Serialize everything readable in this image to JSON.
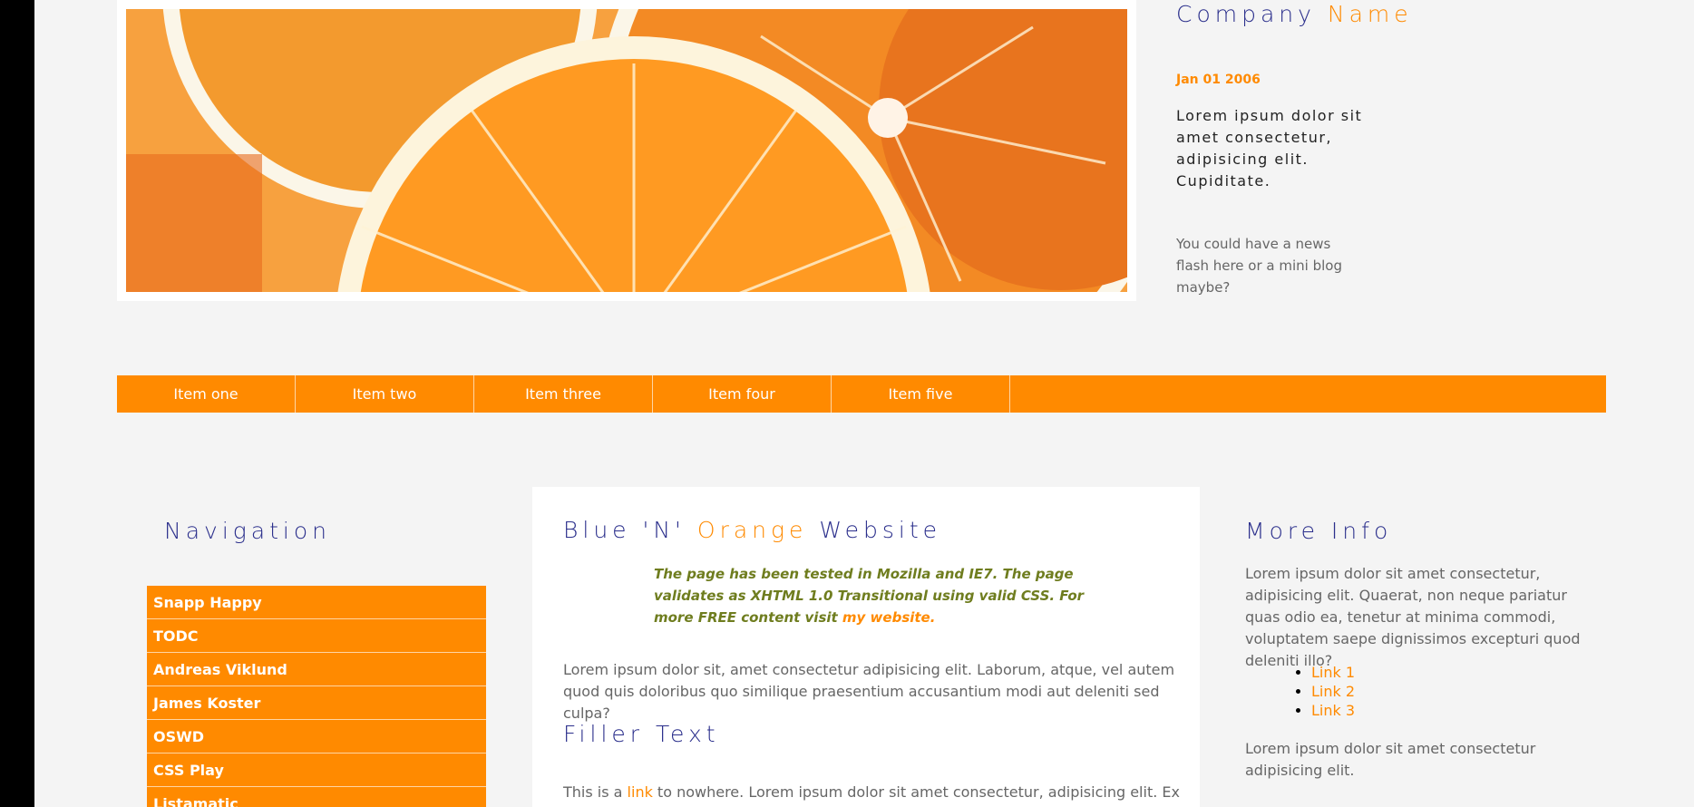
{
  "header": {
    "company_first": "Company",
    "company_second": "Name",
    "date": "Jan 01 2006",
    "tagline": "Lorem ipsum dolor sit amet consectetur, adipisicing elit. Cupiditate.",
    "news": "You could have a news flash here or a mini blog maybe?"
  },
  "topnav": {
    "items": [
      "Item one",
      "Item two",
      "Item three",
      "Item four",
      "Item five"
    ]
  },
  "sidebar": {
    "title": "Navigation",
    "items": [
      "Snapp Happy",
      "TODC",
      "Andreas Viklund",
      "James Koster",
      "OSWD",
      "CSS Play",
      "Listamatic"
    ]
  },
  "main": {
    "title_part1": "Blue 'N' ",
    "title_part2": "Orange",
    "title_part3": " Website",
    "quote_text": "The page has been tested in Mozilla and IE7. The page validates as XHTML 1.0 Transitional using valid CSS. For more FREE content visit ",
    "quote_link": "my website.",
    "para1": "Lorem ipsum dolor sit, amet consectetur adipisicing elit. Laborum, atque, vel autem quod quis doloribus quo similique praesentium accusantium modi aut deleniti sed culpa?",
    "filler_title": "Filler Text",
    "para2_before": "This is a ",
    "para2_link": "link",
    "para2_after": " to nowhere. Lorem ipsum dolor sit amet consectetur, adipisicing elit. Ex sapiente"
  },
  "more_info": {
    "title": "More Info",
    "para1": "Lorem ipsum dolor sit amet consectetur, adipisicing elit. Quaerat, non neque pariatur quas odio ea, tenetur at minima commodi, voluptatem saepe dignissimos excepturi quod deleniti illo?",
    "links": [
      "Link 1",
      "Link 2",
      "Link 3"
    ],
    "para2": "Lorem ipsum dolor sit amet consectetur adipisicing elit."
  },
  "colors": {
    "accent": "#ff8a00",
    "heading": "#2b2f8c",
    "quote": "#6f7d1f"
  }
}
